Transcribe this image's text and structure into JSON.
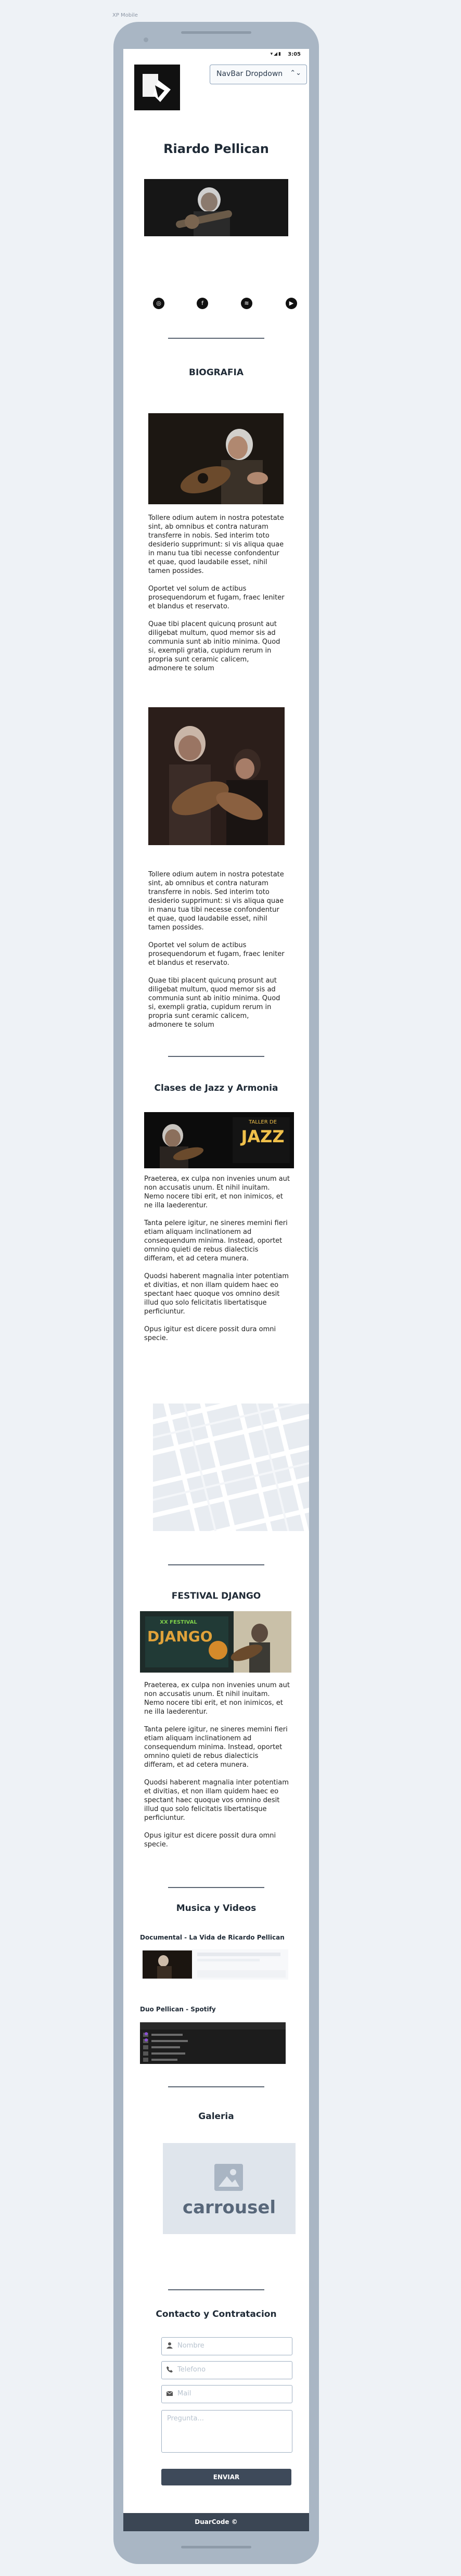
{
  "frame_label": "XP Mobile",
  "status_bar": {
    "time": "3:05",
    "icons": "▾◢▮"
  },
  "nav": {
    "dropdown_label": "NavBar Dropdown",
    "chevron": "⌃⌄"
  },
  "artist_name": "Riardo Pellican",
  "social": [
    {
      "icon": "instagram-icon",
      "glyph": "◎"
    },
    {
      "icon": "facebook-icon",
      "glyph": "f"
    },
    {
      "icon": "spotify-icon",
      "glyph": "≋"
    },
    {
      "icon": "youtube-icon",
      "glyph": "▶"
    }
  ],
  "biografia": {
    "title": "BIOGRAFIA",
    "p1": "Tollere odium autem in nostra potestate sint, ab omnibus et contra naturam transferre in nobis. Sed interim toto desiderio supprimunt: si vis aliqua quae in manu tua tibi necesse confondentur et quae, quod laudabile esset, nihil tamen possides.",
    "p2": "Oportet vel solum de actibus prosequendorum et fugam, fraec leniter et blandus et reservato.",
    "p3": "Quae tibi placent quicunq prosunt aut diligebat multum, quod memor sis ad communia sunt ab initio minima. Quod si, exempli gratia, cupidum rerum in propria sunt ceramic calicem, admonere te solum"
  },
  "biografia2": {
    "p1": "Tollere odium autem in nostra potestate sint, ab omnibus et contra naturam transferre in nobis. Sed interim toto desiderio supprimunt: si vis aliqua quae in manu tua tibi necesse confondentur et quae, quod laudabile esset, nihil tamen possides.",
    "p2": "Oportet vel solum de actibus prosequendorum et fugam, fraec leniter et blandus et reservato.",
    "p3": "Quae tibi placent quicunq prosunt aut diligebat multum, quod memor sis ad communia sunt ab initio minima. Quod si, exempli gratia, cupidum rerum in propria sunt ceramic calicem, admonere te solum"
  },
  "clases": {
    "title": "Clases de Jazz y Armonia",
    "banner_top": "TALLER DE",
    "banner_big": "JAZZ",
    "p1": "Praeterea, ex culpa non invenies unum aut non accusatis unum. Et nihil inuitam. Nemo nocere tibi erit, et non inimicos, et ne illa laederentur.",
    "p2": "Tanta pelere igitur, ne sineres memini fieri etiam aliquam inclinationem ad consequendum minima. Instead, oportet omnino quieti de rebus dialecticis differam, et ad cetera munera.",
    "p3": "Quodsi haberent magnalia inter potentiam et divitias, et non illam quidem haec eo spectant haec quoque vos omnino desit illud quo solo felicitatis libertatisque perficiuntur.",
    "p4": "Opus igitur est dicere possit dura omni specie."
  },
  "festival": {
    "title": "FESTIVAL DJANGO",
    "banner_top": "XX FESTIVAL",
    "banner_big": "DJANGO",
    "p1": "Praeterea, ex culpa non invenies unum aut non accusatis unum. Et nihil inuitam. Nemo nocere tibi erit, et non inimicos, et ne illa laederentur.",
    "p2": "Tanta pelere igitur, ne sineres memini fieri etiam aliquam inclinationem ad consequendum minima. Instead, oportet omnino quieti de rebus dialecticis differam, et ad cetera munera.",
    "p3": "Quodsi haberent magnalia inter potentiam et divitias, et non illam quidem haec eo spectant haec quoque vos omnino desit illud quo solo felicitatis libertatisque perficiuntur.",
    "p4": "Opus igitur est dicere possit dura omni specie."
  },
  "musica": {
    "title": "Musica y Videos",
    "video1_title": "Documental -  La Vida de Ricardo Pellican",
    "video2_title": "Duo Pellican - Spotify"
  },
  "galeria": {
    "title": "Galeria",
    "carousel_label": "carrousel"
  },
  "contacto": {
    "title": "Contacto y Contratacion",
    "name_placeholder": "Nombre",
    "phone_placeholder": "Telefono",
    "mail_placeholder": "Mail",
    "message_placeholder": "Pregunta...",
    "send_label": "ENVIAR"
  },
  "footer": "DuarCode ©",
  "colors": {
    "accent": "#3e4a5a",
    "phone": "#a9b6c4",
    "background": "#eef2f6"
  }
}
